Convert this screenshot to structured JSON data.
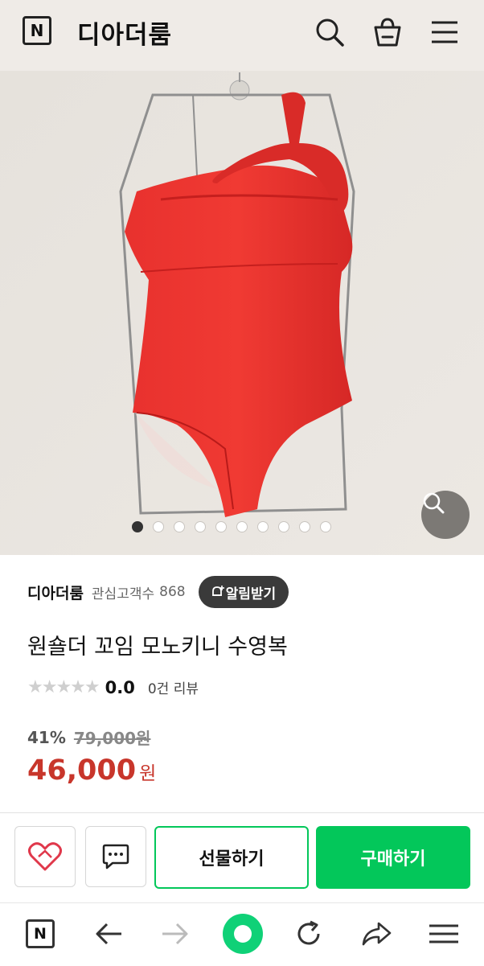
{
  "header": {
    "logo": "N",
    "store_name": "디아더룸",
    "icons": [
      "search-icon",
      "cart-icon",
      "menu-icon"
    ]
  },
  "gallery": {
    "image_count": 10,
    "current_index": 1,
    "zoom_icon": "zoom-icon"
  },
  "seller": {
    "name": "디아더룸",
    "fans_label": "관심고객수",
    "fans_count": "868",
    "alert_label": "알림받기"
  },
  "product": {
    "title": "원숄더 꼬임 모노키니 수영복",
    "rating_stars": "★★★★★",
    "rating_value": "0.0",
    "rating": 0.0,
    "review_text": "0건 리뷰",
    "discount": "41%",
    "original_price": "79,000원",
    "price": "46,000",
    "currency": "원"
  },
  "actions": {
    "gift_label": "선물하기",
    "buy_label": "구매하기"
  },
  "colors": {
    "accent": "#03c75a",
    "price": "#c8362b",
    "header_bg": "#efebe7"
  },
  "bottom_nav": {
    "icons": [
      "naver-home-icon",
      "back-icon",
      "forward-icon",
      "green-dot-icon",
      "refresh-icon",
      "share-icon",
      "menu-icon"
    ]
  }
}
